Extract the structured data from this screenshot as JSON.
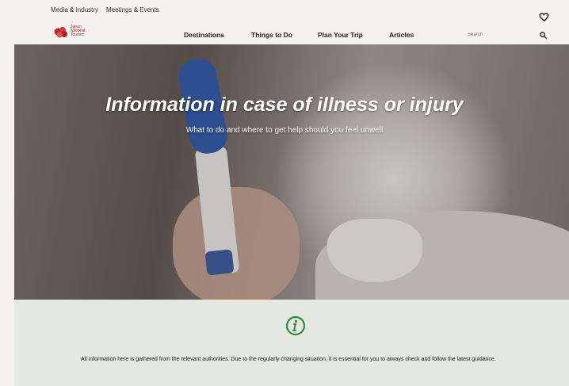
{
  "utility_nav": {
    "items": [
      "Media & Industry",
      "Meetings & Events"
    ]
  },
  "logo": {
    "text_line1": "Japan",
    "text_line2": "National",
    "text_line3": "Tourism"
  },
  "main_nav": {
    "items": [
      "Destinations",
      "Things to Do",
      "Plan Your Trip",
      "Articles"
    ]
  },
  "search": {
    "placeholder": "Search"
  },
  "icons": {
    "favorite": "heart-icon",
    "search": "search-icon",
    "info": "info-icon"
  },
  "hero": {
    "title": "Information in case of illness or injury",
    "subtitle": "What to do and where to get help should you feel unwell"
  },
  "notice": {
    "text": "All information here is gathered from the relevant authorities. Due to the regularly changing situation, it is essential for you to always check and follow the latest guidance."
  },
  "colors": {
    "brand_red": "#b21f2d",
    "info_green": "#2f8a3a",
    "notice_bg": "#e4e8e0"
  }
}
